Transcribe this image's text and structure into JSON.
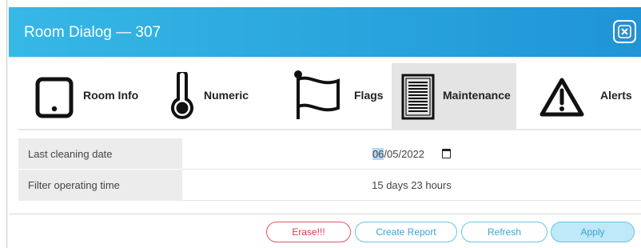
{
  "dialog": {
    "title": "Room Dialog — 307"
  },
  "close": {
    "icon": "close-icon"
  },
  "tabs": [
    {
      "label": "Room Info",
      "icon": "tablet-icon"
    },
    {
      "label": "Numeric",
      "icon": "thermometer-icon"
    },
    {
      "label": "Flags",
      "icon": "flag-icon"
    },
    {
      "label": "Maintenance",
      "icon": "list-document-icon",
      "active": true
    },
    {
      "label": "Alerts",
      "icon": "warning-icon"
    }
  ],
  "fields": {
    "cleaning": {
      "label": "Last cleaning date",
      "date_selected": "06",
      "date_rest": "/05/2022"
    },
    "filter": {
      "label": "Filter operating time",
      "value": "15 days 23 hours"
    }
  },
  "buttons": {
    "erase": "Erase!!!",
    "report": "Create Report",
    "refresh": "Refresh",
    "apply": "Apply"
  },
  "colors": {
    "titlebar": "#1f94d6",
    "active_tab": "#e4e4e4",
    "erase": "#d83a50",
    "accent": "#3aa3d3"
  }
}
